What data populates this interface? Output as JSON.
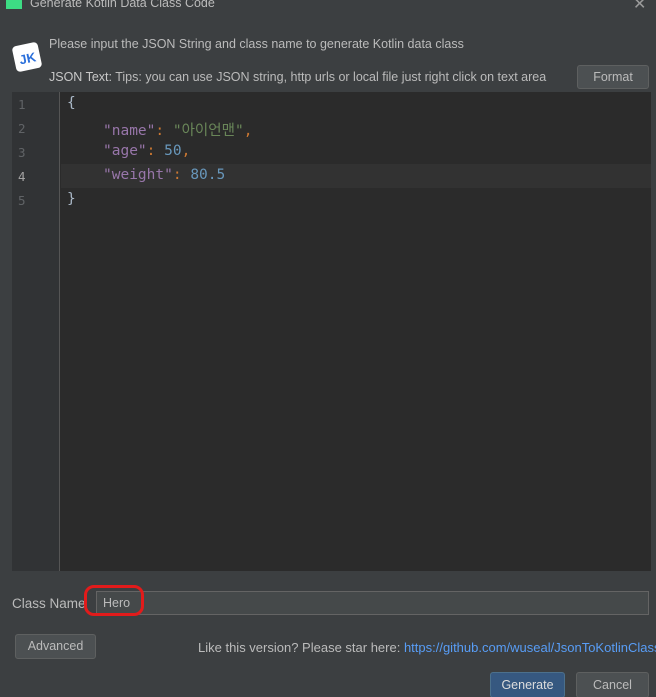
{
  "window": {
    "title": "Generate Kotlin Data Class Code",
    "close_glyph": "✕"
  },
  "header": {
    "logo_text": "JK",
    "description": "Please input the JSON String and class name to generate Kotlin data class",
    "tips_label": "JSON Text:",
    "tips_text": " Tips: you can use JSON string, http urls or local file just right click on text area",
    "format_label": "Format"
  },
  "editor": {
    "line_numbers": [
      "1",
      "2",
      "3",
      "4",
      "5"
    ],
    "active_line": 4,
    "lines": [
      {
        "open": "{"
      },
      {
        "key": "\"name\"",
        "colon": ": ",
        "value": "\"아이언맨\"",
        "comma": ","
      },
      {
        "key": "\"age\"",
        "colon": ": ",
        "value": "50",
        "comma": ","
      },
      {
        "key": "\"weight\"",
        "colon": ": ",
        "value": "80.5",
        "comma": ""
      },
      {
        "close": "}"
      }
    ]
  },
  "class_name": {
    "label": "Class Name",
    "value": "Hero"
  },
  "footer": {
    "advanced_label": "Advanced",
    "star_text": "Like this version? Please star here: ",
    "star_link": "https://github.com/wuseal/JsonToKotlinClass",
    "generate_label": "Generate",
    "cancel_label": "Cancel"
  },
  "colors": {
    "background": "#3c3f41",
    "editor_background": "#2b2b2b",
    "json_key": "#9876aa",
    "json_string": "#6a8759",
    "json_number": "#6897bb",
    "link": "#589df6",
    "primary_button": "#365880",
    "annotation_ring": "#e21b1b"
  }
}
